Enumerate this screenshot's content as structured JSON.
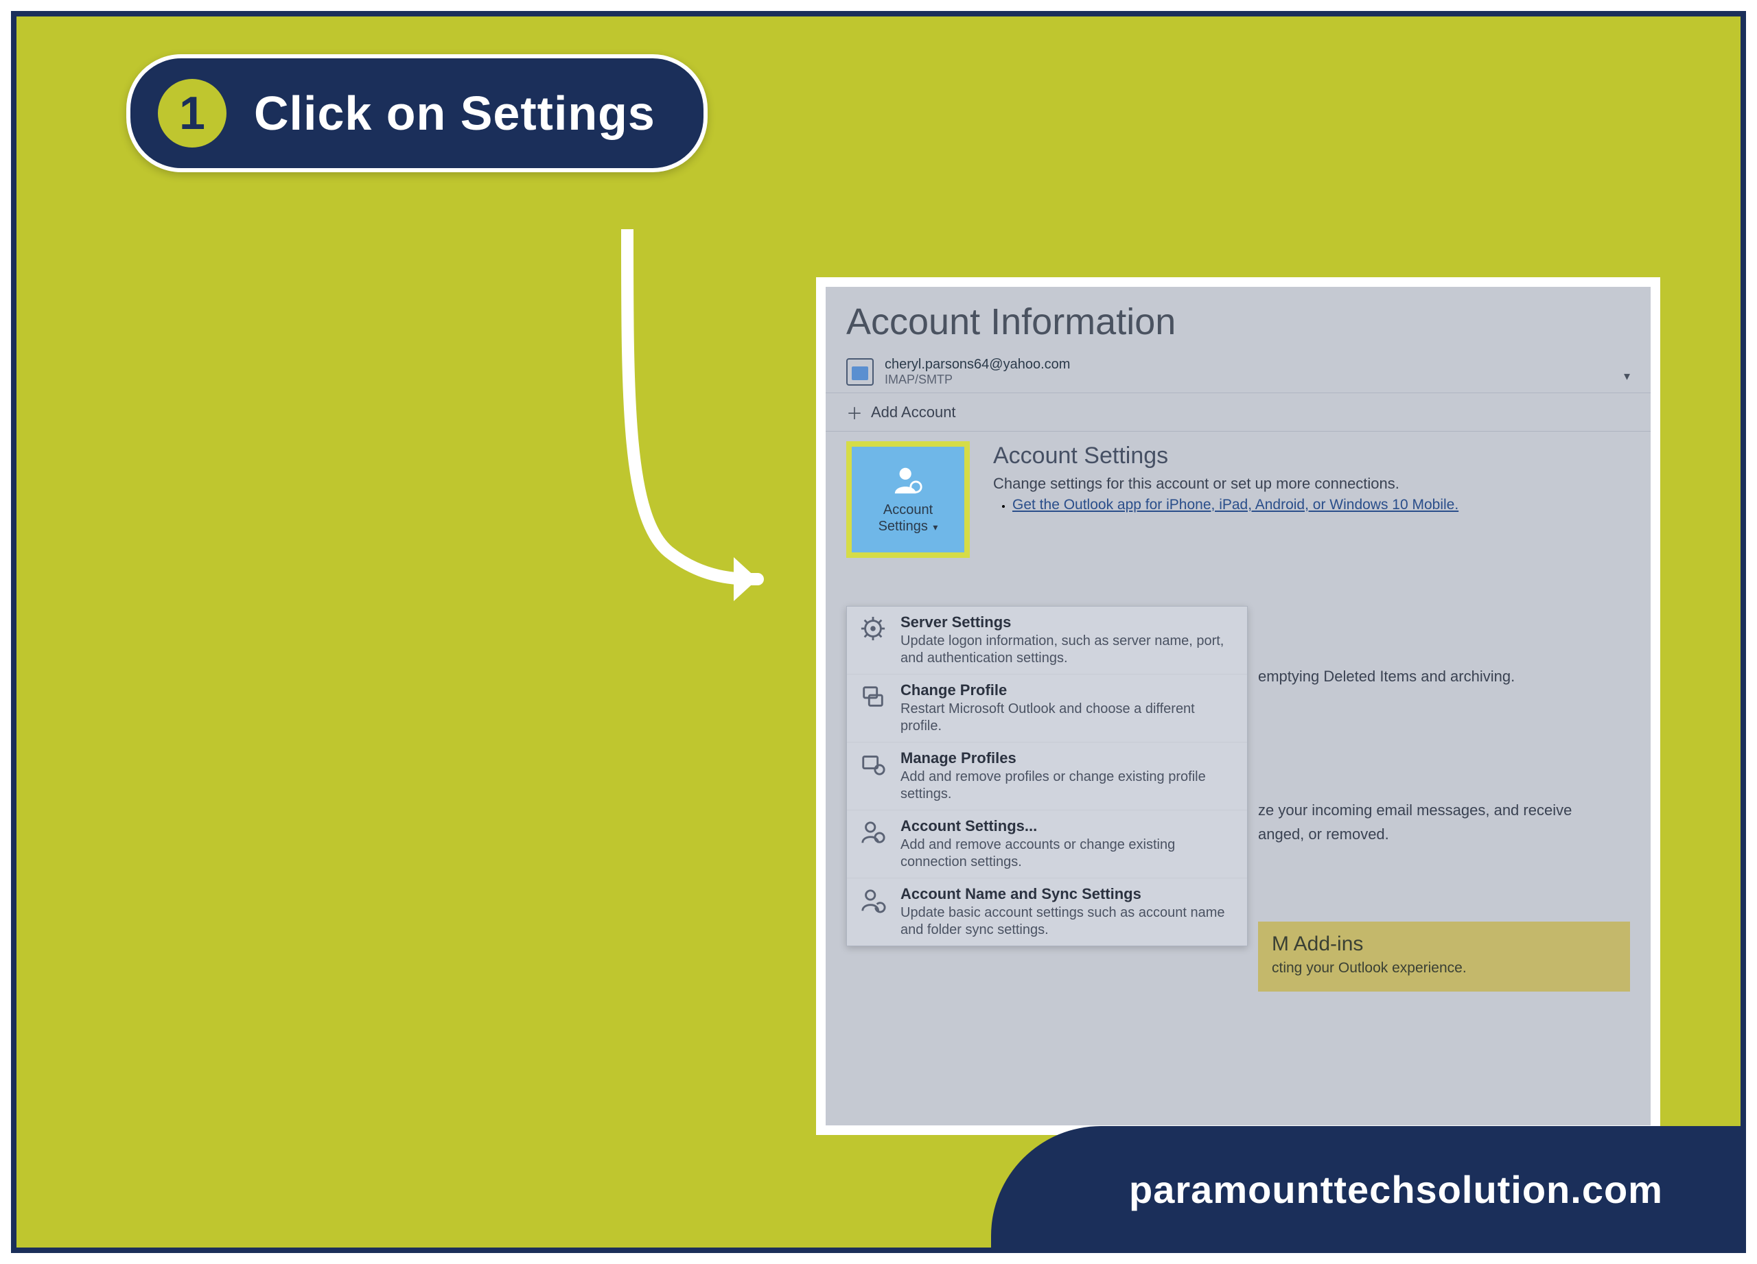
{
  "step": {
    "number": "1",
    "label": "Click on Settings"
  },
  "app": {
    "title": "Account Information",
    "account_email": "cheryl.parsons64@yahoo.com",
    "account_type": "IMAP/SMTP",
    "add_account": "Add Account",
    "acct_settings_btn": "Account\nSettings",
    "section": {
      "heading": "Account Settings",
      "desc": "Change settings for this account or set up more connections.",
      "link": "Get the Outlook app for iPhone, iPad, Android, or Windows 10 Mobile."
    },
    "bg_line1": "emptying Deleted Items and archiving.",
    "bg_line2": "ze your incoming email messages, and receive",
    "bg_line3": "anged, or removed.",
    "addins_title": "M Add-ins",
    "addins_desc": "cting your Outlook experience.",
    "dropdown": [
      {
        "title": "Server Settings",
        "desc": "Update logon information, such as server name, port, and authentication settings."
      },
      {
        "title": "Change Profile",
        "desc": "Restart Microsoft Outlook and choose a different profile."
      },
      {
        "title": "Manage Profiles",
        "desc": "Add and remove profiles or change existing profile settings."
      },
      {
        "title": "Account Settings...",
        "desc": "Add and remove accounts or change existing connection settings."
      },
      {
        "title": "Account Name and Sync Settings",
        "desc": "Update basic account settings such as account name and folder sync settings."
      }
    ]
  },
  "footer": "paramounttechsolution.com"
}
